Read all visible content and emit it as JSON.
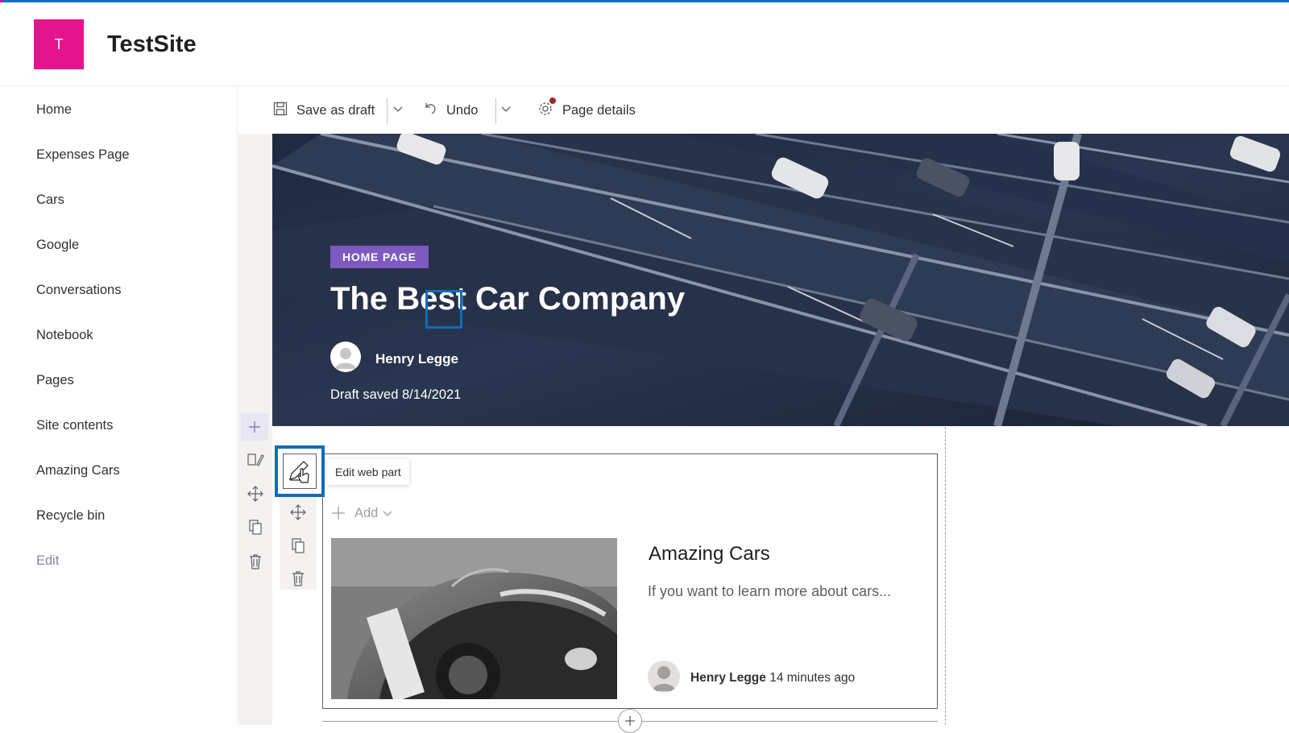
{
  "site": {
    "logo_letter": "T",
    "title": "TestSite",
    "logo_color": "#e3148c"
  },
  "nav": {
    "items": [
      {
        "label": "Home"
      },
      {
        "label": "Expenses Page"
      },
      {
        "label": "Cars"
      },
      {
        "label": "Google"
      },
      {
        "label": "Conversations"
      },
      {
        "label": "Notebook"
      },
      {
        "label": "Pages"
      },
      {
        "label": "Site contents"
      },
      {
        "label": "Amazing Cars"
      },
      {
        "label": "Recycle bin"
      }
    ],
    "edit_label": "Edit"
  },
  "toolbar": {
    "save_label": "Save as draft",
    "undo_label": "Undo",
    "details_label": "Page details"
  },
  "hero": {
    "badge": "HOME PAGE",
    "title": "The Best Car Company",
    "author": "Henry Legge",
    "draft_status": "Draft saved 8/14/2021"
  },
  "webpart": {
    "tooltip": "Edit web part",
    "add_label": "Add",
    "card": {
      "title": "Amazing Cars",
      "description": "If you want to learn more about cars...",
      "author": "Henry Legge",
      "time": "14 minutes ago"
    }
  },
  "colors": {
    "accent": "#0f6cbd",
    "badge": "#7c5ac2",
    "selection": "#0f6cbd"
  }
}
